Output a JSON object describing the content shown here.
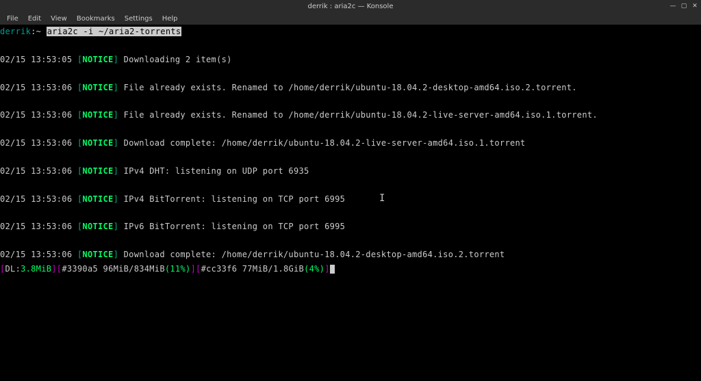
{
  "titlebar": {
    "title": "derrik : aria2c — Konsole",
    "minimize": "—",
    "maximize": "▢",
    "close": "✕"
  },
  "menubar": {
    "items": [
      {
        "label": "File"
      },
      {
        "label": "Edit"
      },
      {
        "label": "View"
      },
      {
        "label": "Bookmarks"
      },
      {
        "label": "Settings"
      },
      {
        "label": "Help"
      }
    ]
  },
  "prompt": {
    "user": "derrik",
    "path": ":~",
    "command": "aria2c -i ~/aria2-torrents"
  },
  "logs": [
    {
      "ts": "02/15 13:53:05",
      "tag": "NOTICE",
      "msg": "Downloading 2 item(s)"
    },
    {
      "ts": "02/15 13:53:06",
      "tag": "NOTICE",
      "msg": "File already exists. Renamed to /home/derrik/ubuntu-18.04.2-desktop-amd64.iso.2.torrent."
    },
    {
      "ts": "02/15 13:53:06",
      "tag": "NOTICE",
      "msg": "File already exists. Renamed to /home/derrik/ubuntu-18.04.2-live-server-amd64.iso.1.torrent."
    },
    {
      "ts": "02/15 13:53:06",
      "tag": "NOTICE",
      "msg": "Download complete: /home/derrik/ubuntu-18.04.2-live-server-amd64.iso.1.torrent"
    },
    {
      "ts": "02/15 13:53:06",
      "tag": "NOTICE",
      "msg": "IPv4 DHT: listening on UDP port 6935"
    },
    {
      "ts": "02/15 13:53:06",
      "tag": "NOTICE",
      "msg": "IPv4 BitTorrent: listening on TCP port 6995"
    },
    {
      "ts": "02/15 13:53:06",
      "tag": "NOTICE",
      "msg": "IPv6 BitTorrent: listening on TCP port 6995"
    },
    {
      "ts": "02/15 13:53:06",
      "tag": "NOTICE",
      "msg": "Download complete: /home/derrik/ubuntu-18.04.2-desktop-amd64.iso.2.torrent"
    }
  ],
  "progress": {
    "dl_label": "DL:",
    "dl_speed": "3.8MiB",
    "t1_id": "#3390a5",
    "t1_done": "96MiB",
    "t1_total": "834MiB",
    "t1_pct": "11%",
    "t2_id": "#cc33f6",
    "t2_done": "77MiB",
    "t2_total": "1.8GiB",
    "t2_pct": "4%"
  }
}
